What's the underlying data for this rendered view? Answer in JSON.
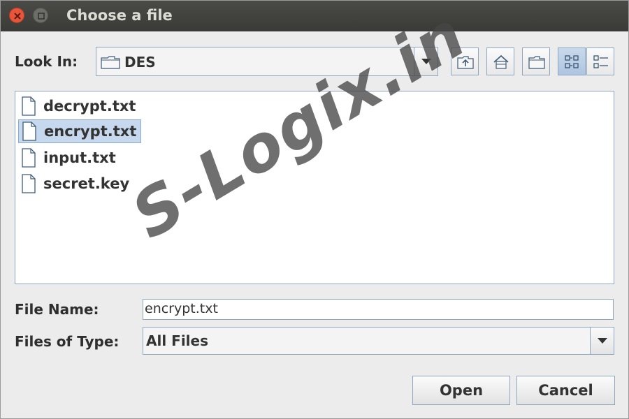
{
  "window": {
    "title": "Choose a file"
  },
  "look_in": {
    "label": "Look In:",
    "value": "DES"
  },
  "toolbar": {
    "buttons": [
      "up-one-level-icon",
      "home-icon",
      "new-folder-icon",
      "list-view-icon",
      "details-view-icon"
    ]
  },
  "files": [
    {
      "name": "decrypt.txt",
      "selected": false
    },
    {
      "name": "encrypt.txt",
      "selected": true
    },
    {
      "name": "input.txt",
      "selected": false
    },
    {
      "name": "secret.key",
      "selected": false
    }
  ],
  "file_name": {
    "label": "File Name:",
    "value": "encrypt.txt"
  },
  "file_type": {
    "label": "Files of Type:",
    "value": "All Files"
  },
  "actions": {
    "open_label": "Open",
    "cancel_label": "Cancel"
  },
  "watermark": {
    "text": "S-Logix.in"
  },
  "colors": {
    "selection": "#c6d8ee",
    "border": "#8ea6bf",
    "close_button": "#e9553b",
    "titlebar": "#3f3f3c"
  }
}
